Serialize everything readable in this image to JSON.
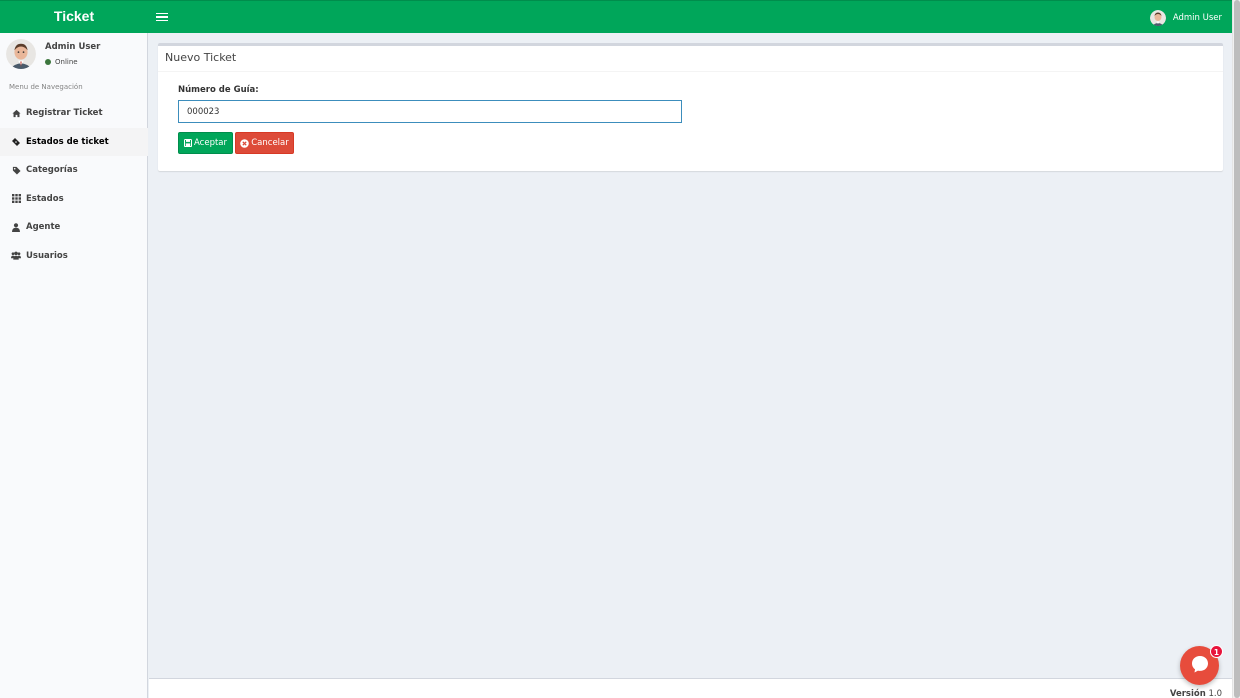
{
  "header": {
    "brand": "Ticket",
    "user_name": "Admin User",
    "color": "#00a65a"
  },
  "sidebar": {
    "user_name": "Admin User",
    "status": "Online",
    "nav_header": "Menu de Navegación",
    "items": [
      {
        "label": "Registrar Ticket",
        "icon": "home-icon"
      },
      {
        "label": "Estados de ticket",
        "icon": "ticket-icon",
        "active": true
      },
      {
        "label": "Categorías",
        "icon": "tag-icon"
      },
      {
        "label": "Estados",
        "icon": "grid-icon"
      },
      {
        "label": "Agente",
        "icon": "user-icon"
      },
      {
        "label": "Usuarios",
        "icon": "users-icon"
      }
    ]
  },
  "box": {
    "title": "Nuevo Ticket",
    "field_label": "Número de Guía:",
    "field_value": "000023",
    "accept_label": "Aceptar",
    "cancel_label": "Cancelar"
  },
  "footer": {
    "version_label": "Versión",
    "version": "1.0"
  },
  "chat": {
    "badge": "1",
    "icon": "chat-icon",
    "color": "#e74c3c"
  }
}
